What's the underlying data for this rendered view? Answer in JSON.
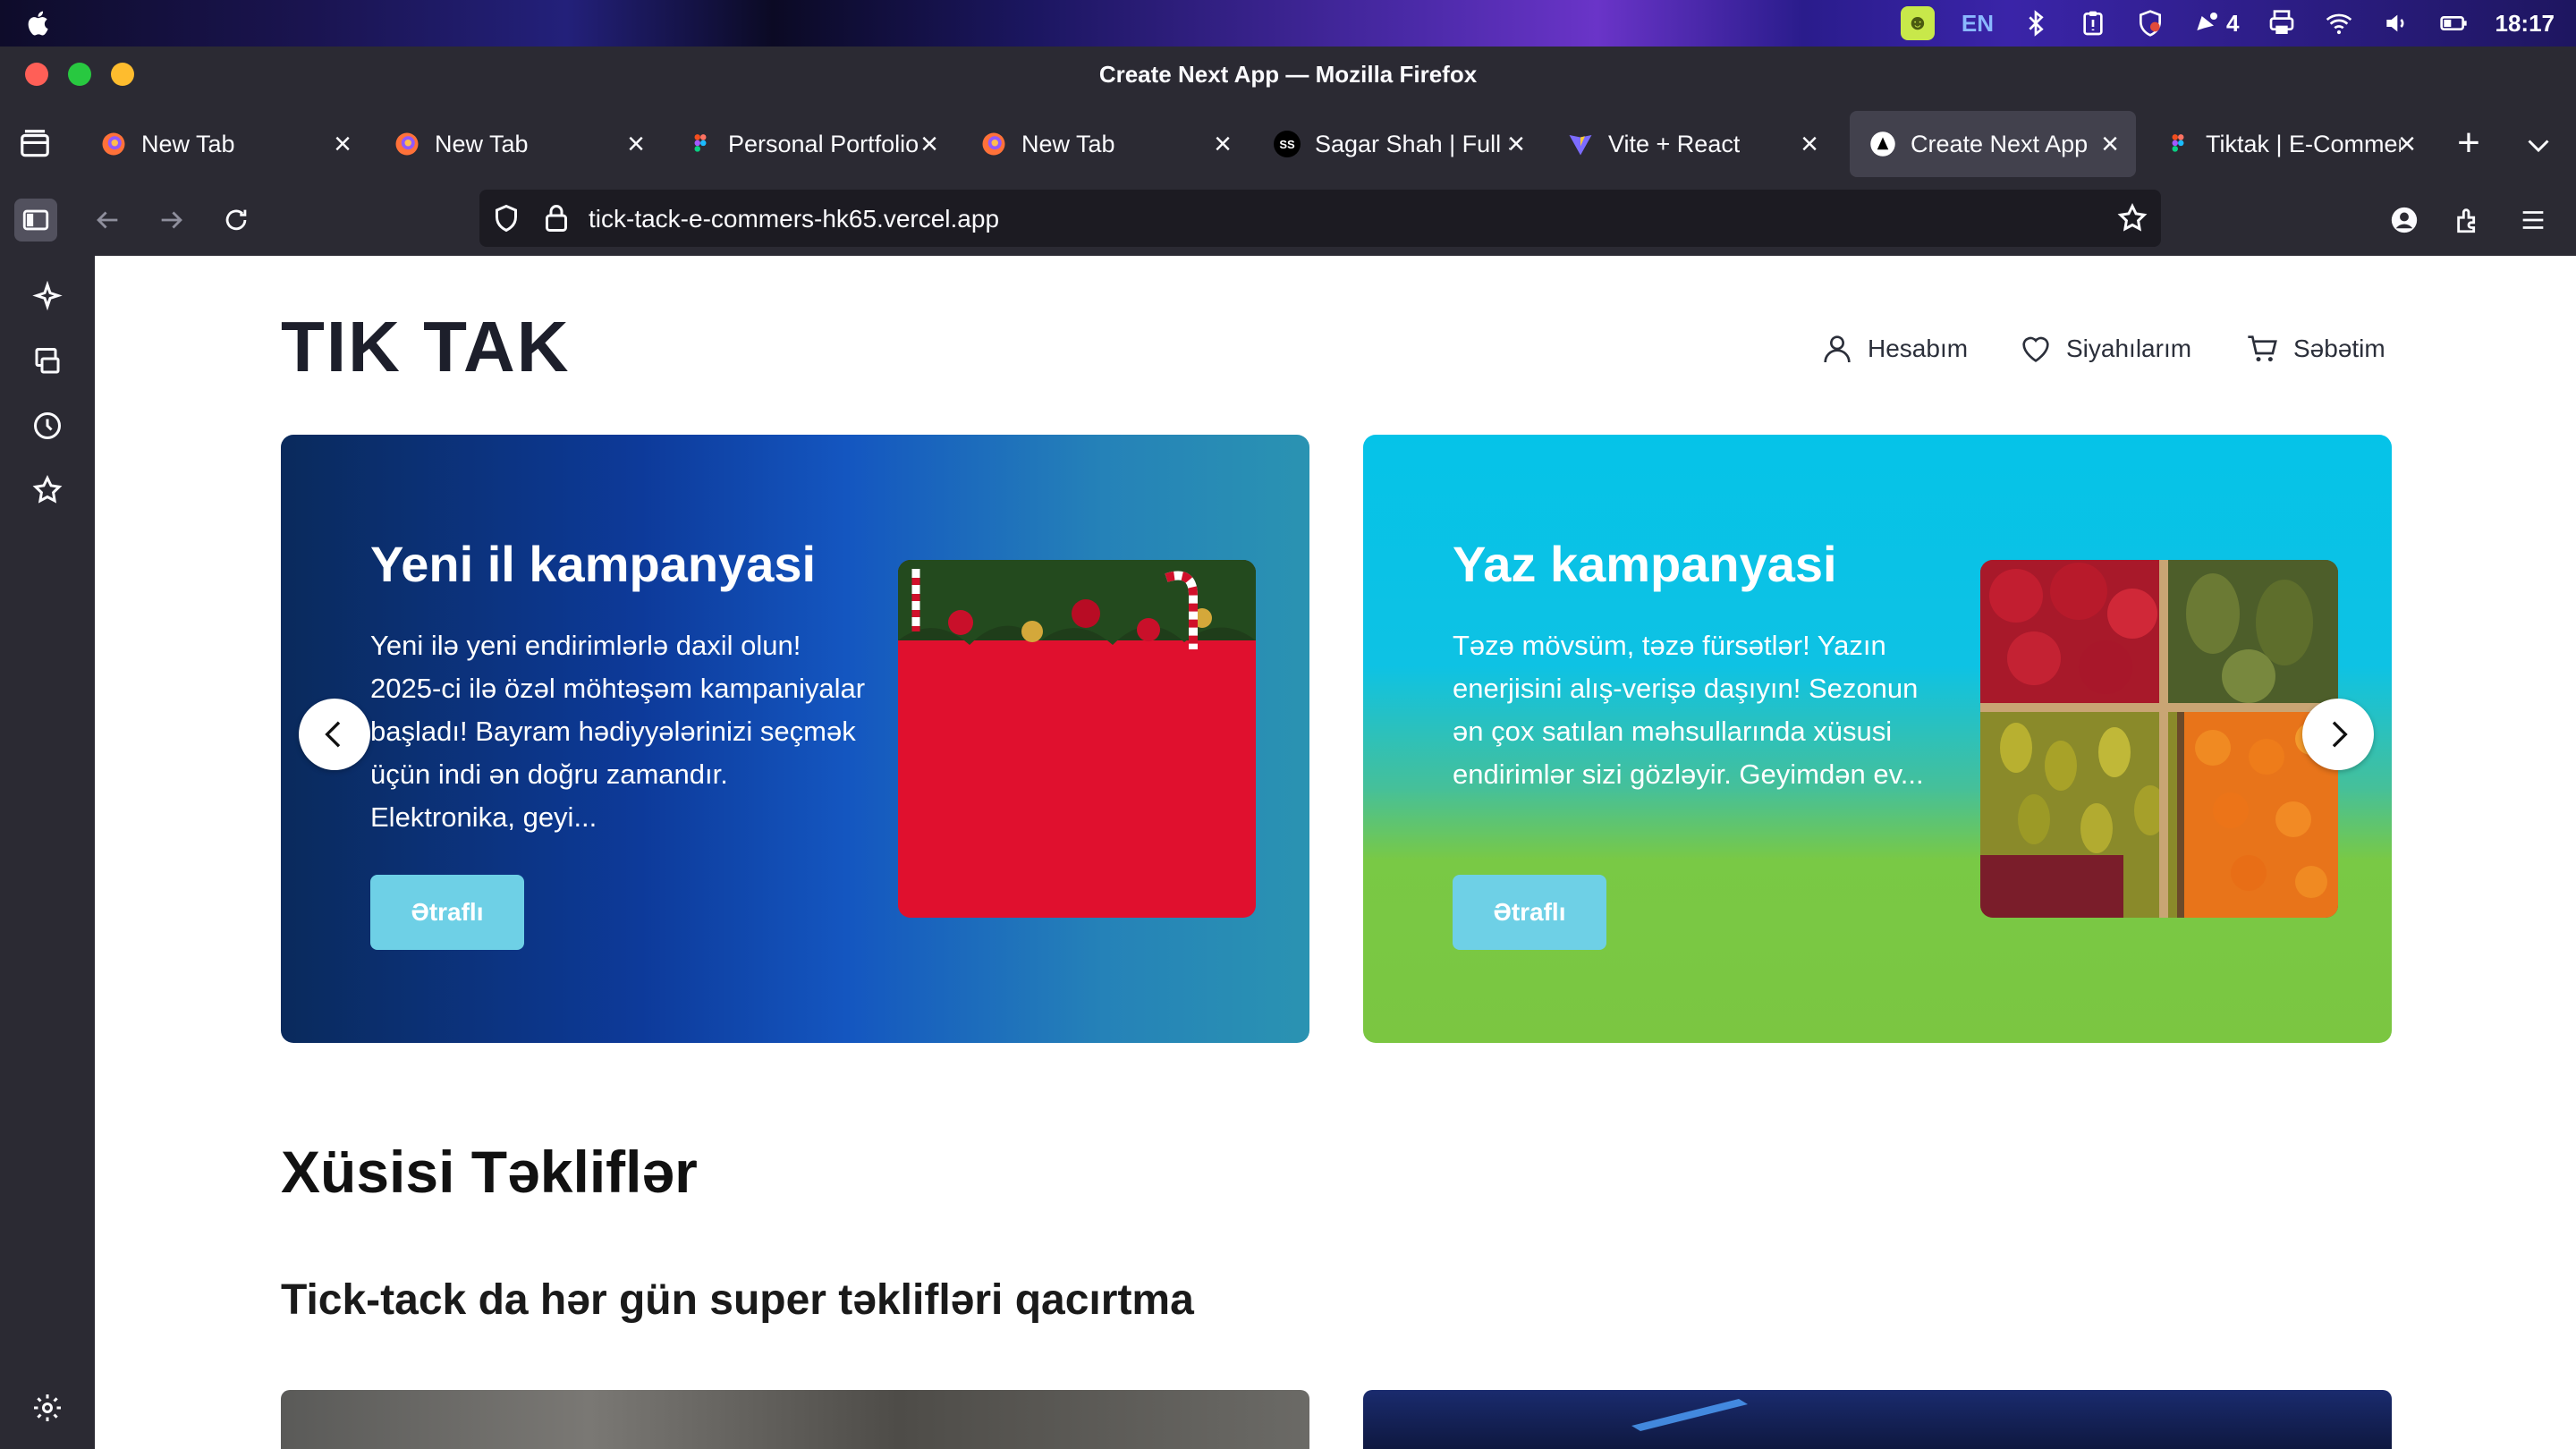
{
  "menubar": {
    "lang": "EN",
    "notifications_count": "4",
    "clock": "18:17"
  },
  "window": {
    "title": "Create Next App — Mozilla Firefox"
  },
  "tabs": [
    {
      "title": "New Tab",
      "favicon": "firefox-icon"
    },
    {
      "title": "New Tab",
      "favicon": "firefox-icon"
    },
    {
      "title": "Personal Portfolio",
      "favicon": "figma-icon"
    },
    {
      "title": "New Tab",
      "favicon": "firefox-icon"
    },
    {
      "title": "Sagar Shah | Full S",
      "favicon": "ss-icon",
      "favicon_text": "SS"
    },
    {
      "title": "Vite + React",
      "favicon": "vite-icon"
    },
    {
      "title": "Create Next App",
      "favicon": "next-icon",
      "active": true
    },
    {
      "title": "Tiktak | E-Commer",
      "favicon": "figma-icon"
    }
  ],
  "navbar": {
    "url": "tick-tack-e-commers-hk65.vercel.app"
  },
  "site": {
    "logo": "TIK TAK",
    "nav": {
      "account": "Hesabım",
      "wishlist": "Siyahılarım",
      "cart": "Səbətim"
    },
    "slides": [
      {
        "title": "Yeni il kampanyasi",
        "text": "Yeni ilə yeni endirimlərlə daxil olun! 2025-ci ilə özəl möhtəşəm kampaniyalar başladı! Bayram hədiyyələrinizi seçmək üçün indi ən doğru zamandır. Elektronika, geyi...",
        "button": "Ətraflı"
      },
      {
        "title": "Yaz kampanyasi",
        "text": "Təzə mövsüm, təzə fürsətlər! Yazın enerjisini alış-verişə daşıyın! Sezonun ən çox satılan məhsullarında xüsusi endirimlər sizi gözləyir. Geyimdən ev...",
        "button": "Ətraflı"
      }
    ],
    "section": {
      "title": "Xüsisi Təkliflər",
      "subtitle": "Tick-tack da hər gün super təklifləri qacırtma"
    }
  },
  "colors": {
    "accent_button": "#6ed0e6",
    "chrome_bg": "#2b2a33",
    "logo": "#1d1f2b"
  }
}
